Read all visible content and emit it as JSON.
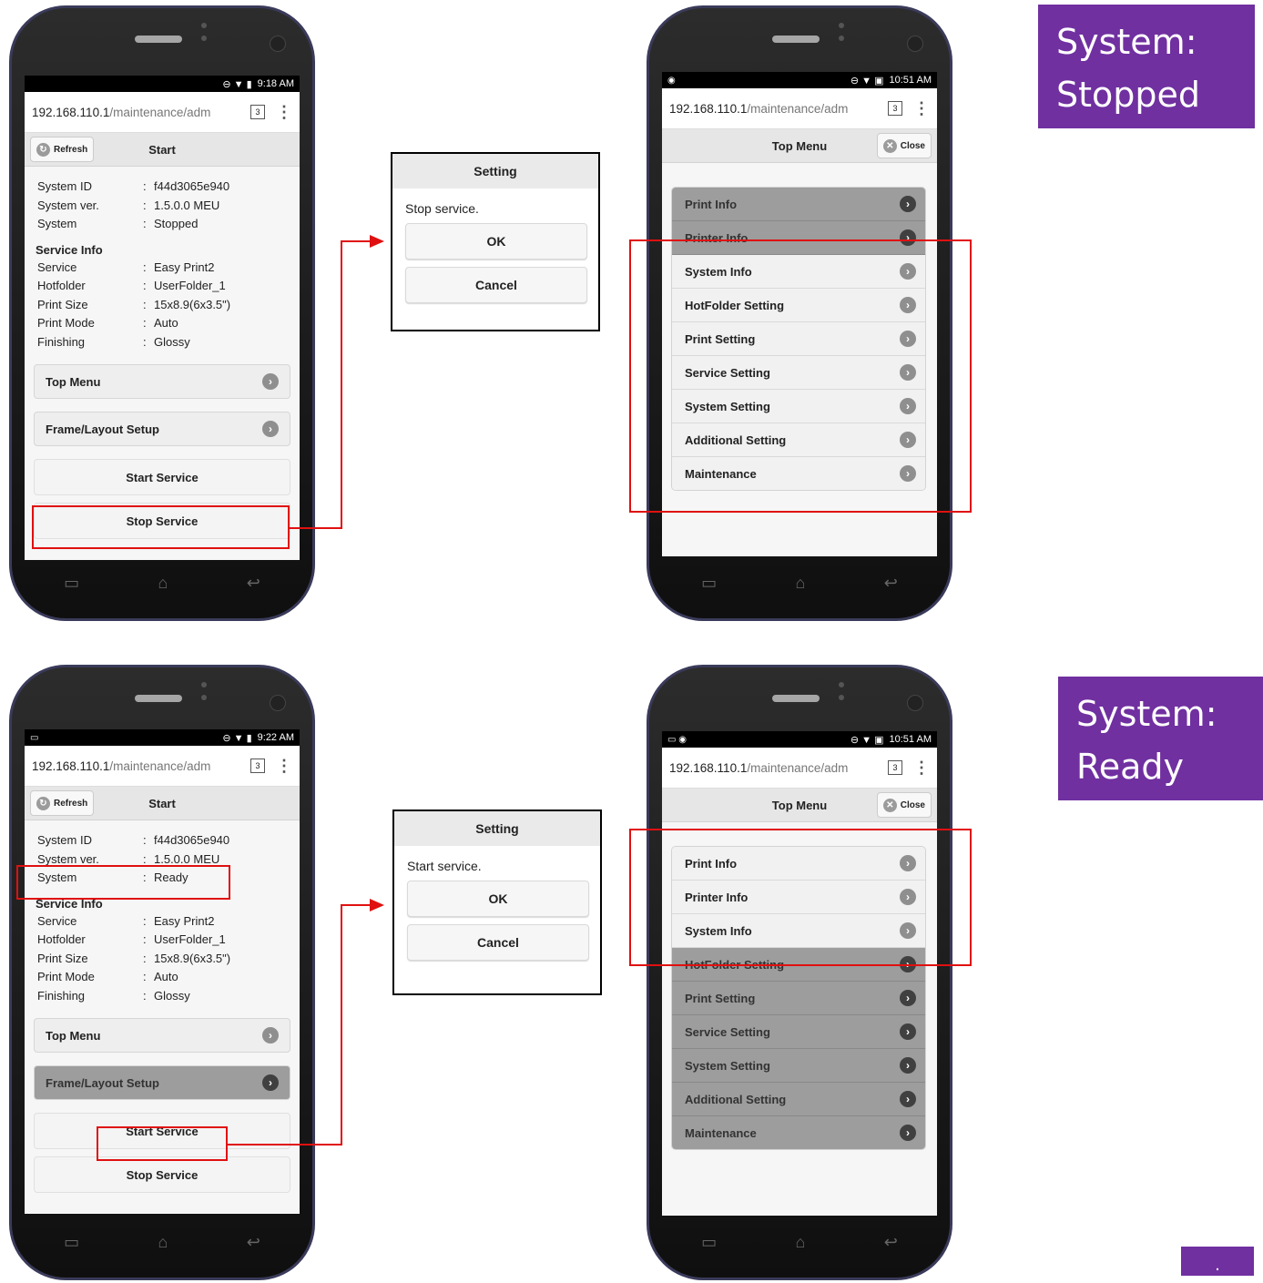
{
  "url": {
    "host": "192.168.110.1",
    "path": "/maintenance/adm",
    "tabs": "3"
  },
  "nav_icons": {
    "recent": "▭",
    "home": "⌂",
    "back": "↩"
  },
  "colors": {
    "callout": "#7030a0",
    "highlight": "#e01010"
  },
  "phones": {
    "start_stopped": {
      "time": "9:18 AM",
      "header": {
        "refresh": "Refresh",
        "title": "Start"
      },
      "system_info": [
        {
          "label": "System ID",
          "value": "f44d3065e940"
        },
        {
          "label": "System ver.",
          "value": "1.5.0.0 MEU"
        },
        {
          "label": "System",
          "value": "Stopped"
        }
      ],
      "service_title": "Service Info",
      "service_info": [
        {
          "label": "Service",
          "value": "Easy Print2"
        },
        {
          "label": "Hotfolder",
          "value": "UserFolder_1"
        },
        {
          "label": "Print Size",
          "value": "15x8.9(6x3.5\")"
        },
        {
          "label": "Print Mode",
          "value": "Auto"
        },
        {
          "label": "Finishing",
          "value": "Glossy"
        }
      ],
      "top_menu": "Top Menu",
      "frame_layout": "Frame/Layout Setup",
      "start_service": "Start Service",
      "stop_service": "Stop Service"
    },
    "menu_stopped": {
      "time": "10:51 AM",
      "header": {
        "title": "Top Menu",
        "close": "Close"
      },
      "items": [
        "Print Info",
        "Printer Info",
        "System Info",
        "HotFolder Setting",
        "Print Setting",
        "Service Setting",
        "System Setting",
        "Additional Setting",
        "Maintenance"
      ]
    },
    "start_ready": {
      "time": "9:22 AM",
      "header": {
        "refresh": "Refresh",
        "title": "Start"
      },
      "system_info": [
        {
          "label": "System ID",
          "value": "f44d3065e940"
        },
        {
          "label": "System ver.",
          "value": "1.5.0.0 MEU"
        },
        {
          "label": "System",
          "value": "Ready"
        }
      ],
      "service_title": "Service Info",
      "service_info": [
        {
          "label": "Service",
          "value": "Easy Print2"
        },
        {
          "label": "Hotfolder",
          "value": "UserFolder_1"
        },
        {
          "label": "Print Size",
          "value": "15x8.9(6x3.5\")"
        },
        {
          "label": "Print Mode",
          "value": "Auto"
        },
        {
          "label": "Finishing",
          "value": "Glossy"
        }
      ],
      "top_menu": "Top Menu",
      "frame_layout": "Frame/Layout Setup",
      "start_service": "Start Service",
      "stop_service": "Stop Service"
    },
    "menu_ready": {
      "time": "10:51 AM",
      "header": {
        "title": "Top Menu",
        "close": "Close"
      },
      "items": [
        "Print Info",
        "Printer Info",
        "System Info",
        "HotFolder Setting",
        "Print Setting",
        "Service Setting",
        "System Setting",
        "Additional Setting",
        "Maintenance"
      ]
    }
  },
  "dialogs": {
    "stop": {
      "title": "Setting",
      "message": "Stop service.",
      "ok": "OK",
      "cancel": "Cancel"
    },
    "start": {
      "title": "Setting",
      "message": "Start service.",
      "ok": "OK",
      "cancel": "Cancel"
    }
  },
  "callouts": {
    "stopped": {
      "line1": "System:",
      "line2": "Stopped"
    },
    "ready": {
      "line1": "System:",
      "line2": "Ready"
    },
    "corner": "."
  }
}
